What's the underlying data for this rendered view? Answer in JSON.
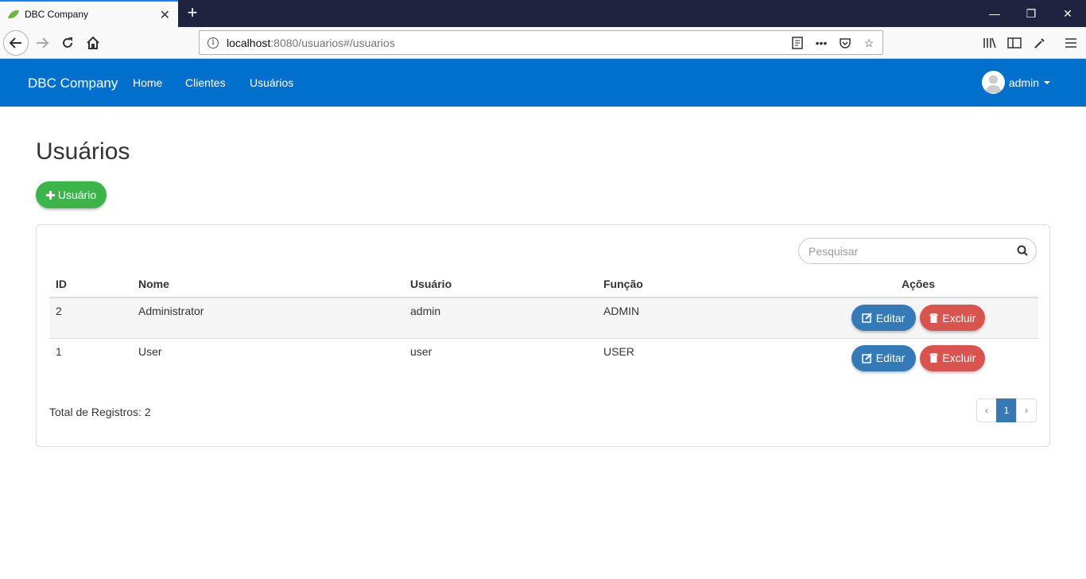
{
  "browser": {
    "tab_title": "DBC Company",
    "url_host": "localhost",
    "url_rest": ":8080/usuarios#/usuarios"
  },
  "nav": {
    "brand": "DBC Company",
    "links": [
      "Home",
      "Clientes",
      "Usuários"
    ],
    "user": "admin"
  },
  "page": {
    "title": "Usuários",
    "add_button": "Usuário"
  },
  "search": {
    "placeholder": "Pesquisar"
  },
  "table": {
    "headers": [
      "ID",
      "Nome",
      "Usuário",
      "Função",
      "Ações"
    ],
    "rows": [
      {
        "id": "2",
        "nome": "Administrator",
        "usuario": "admin",
        "funcao": "ADMIN"
      },
      {
        "id": "1",
        "nome": "User",
        "usuario": "user",
        "funcao": "USER"
      }
    ],
    "edit_label": "Editar",
    "delete_label": "Excluir"
  },
  "footer": {
    "total": "Total de Registros: 2",
    "prev": "‹",
    "page": "1",
    "next": "›"
  },
  "colors": {
    "accent": "#0070cc",
    "success": "#3bb54a",
    "primary": "#337ab7",
    "danger": "#d9534f"
  }
}
